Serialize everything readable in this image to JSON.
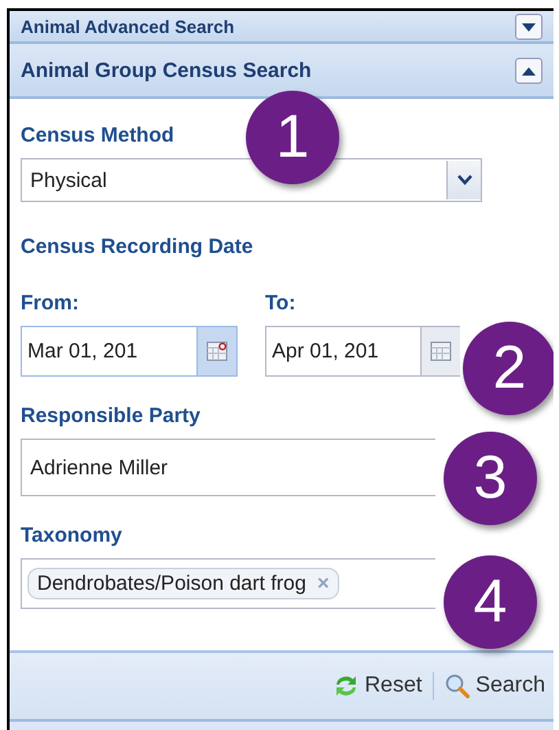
{
  "panels": [
    {
      "title": "Animal Advanced Search",
      "expanded": false
    },
    {
      "title": "Animal Group Census Search",
      "expanded": true
    }
  ],
  "census_method": {
    "label": "Census Method",
    "value": "Physical"
  },
  "recording_date": {
    "label": "Census Recording Date",
    "from_label": "From:",
    "from_value": "Mar 01, 201",
    "to_label": "To:",
    "to_value": "Apr 01, 201"
  },
  "responsible_party": {
    "label": "Responsible Party",
    "value": "Adrienne Miller"
  },
  "taxonomy": {
    "label": "Taxonomy",
    "tags": [
      {
        "text": "Dendrobates/Poison dart frog",
        "remove": "×"
      }
    ]
  },
  "toolbar": {
    "buttons": [
      {
        "kind": "reset",
        "label": "Reset"
      },
      {
        "kind": "search",
        "label": "Search"
      }
    ]
  },
  "callouts": [
    "1",
    "2",
    "3",
    "4"
  ]
}
